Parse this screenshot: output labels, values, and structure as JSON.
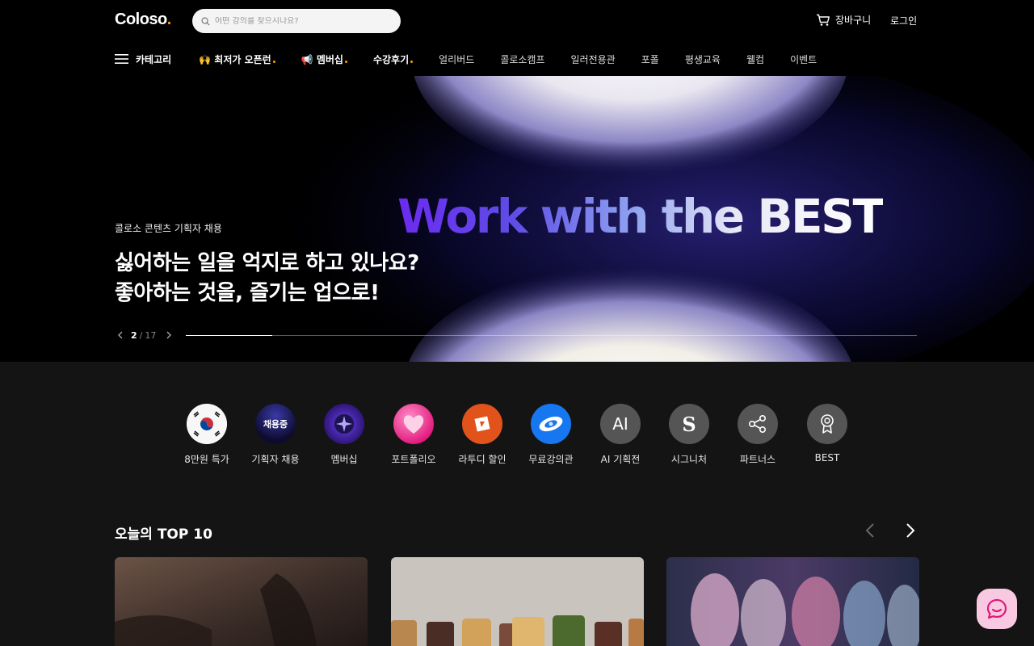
{
  "header": {
    "logo": "Coloso",
    "logo_dot": ".",
    "search_placeholder": "어떤 강의를 찾으시나요?",
    "cart_label": "장바구니",
    "login_label": "로그인"
  },
  "nav": {
    "menu_label": "카테고리",
    "items": [
      {
        "label": "🙌 최저가 오픈런"
      },
      {
        "label": "📢 멤버십"
      },
      {
        "label": "수강후기"
      },
      {
        "label": "얼리버드"
      },
      {
        "label": "콜로소캠프"
      },
      {
        "label": "일러전용관"
      },
      {
        "label": "포폴"
      },
      {
        "label": "평생교육"
      },
      {
        "label": "웰컴"
      },
      {
        "label": "이벤트"
      }
    ]
  },
  "hero": {
    "big_text": "Work with the BEST",
    "eyebrow": "콜로소 콘텐츠 기획자 채용",
    "title_line1": "싫어하는 일을 억지로 하고 있나요?",
    "title_line2": "좋아하는 것을, 즐기는 업으로!",
    "page_current": "2",
    "page_sep": "/",
    "page_total": "17",
    "progress_fraction": 0.118
  },
  "quick_menu": {
    "items": [
      {
        "label": "8만원 특가",
        "icon": "korea-flag-icon"
      },
      {
        "label": "기획자 채용",
        "icon": "hiring-badge-icon",
        "badge_text": "채용중"
      },
      {
        "label": "멤버십",
        "icon": "star-membership-icon"
      },
      {
        "label": "포트폴리오",
        "icon": "heart-portfolio-icon"
      },
      {
        "label": "라투디 할인",
        "icon": "ratudi-icon"
      },
      {
        "label": "무료강의관",
        "icon": "free-lecture-icon"
      },
      {
        "label": "AI 기획전",
        "icon": "ai-icon",
        "badge_text": "AI"
      },
      {
        "label": "시그니처",
        "icon": "signature-icon",
        "badge_text": "S"
      },
      {
        "label": "파트너스",
        "icon": "share-icon"
      },
      {
        "label": "BEST",
        "icon": "award-icon"
      }
    ]
  },
  "top10": {
    "title": "오늘의 TOP 10"
  },
  "colors": {
    "accent": "#ff9d00",
    "header_bg": "#000000",
    "page_bg": "#141414",
    "chat_bg": "#f9c9e2",
    "chat_icon": "#e0177a"
  }
}
